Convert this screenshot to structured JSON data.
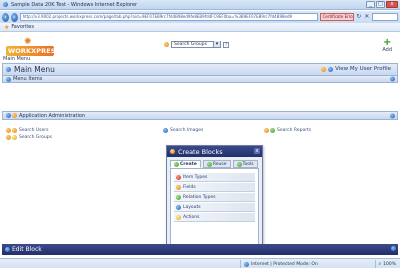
{
  "window": {
    "title": "Sample Data 20K Test - Windows Internet Explorer",
    "controls": [
      "_",
      "□",
      "x"
    ]
  },
  "address_bar": {
    "url": "http://v3.9002.projects.workxpress.com/page/tab.php?oid=9EF07EB9rc7fd4B98ed9fe8EB9fd4FC9EF0ba=%3B9EF07EB9rc7fd4B98ed9",
    "certificate_error": "Certificate Error"
  },
  "favorites": {
    "label": "Favorites"
  },
  "header": {
    "logo_text": "WORKXPRESS",
    "main_menu_label": "Main Menu",
    "group_select_value": "Search Groups",
    "help_label": "?",
    "add_label": "Add",
    "add_symbol": "+"
  },
  "main_menu_bar": {
    "title": "Main Menu",
    "view_my_user_profile": "View My User Profile"
  },
  "menu_items_bar": {
    "label": "Menu Items"
  },
  "app_admin_bar": {
    "label": "Application Administration"
  },
  "admin_links": {
    "search_users": "Search Users",
    "search_groups": "Search Groups",
    "search_images": "Search Images",
    "search_reports": "Search Reports"
  },
  "create_blocks": {
    "title": "Create Blocks",
    "close": "x",
    "tabs": [
      {
        "label": "Create",
        "icon": "create-icon"
      },
      {
        "label": "Reuse",
        "icon": "reuse-icon"
      },
      {
        "label": "Tools",
        "icon": "tools-icon"
      }
    ],
    "items": [
      {
        "label": "Item Types",
        "icon": "item-types-icon"
      },
      {
        "label": "Fields",
        "icon": "fields-icon"
      },
      {
        "label": "Relation Types",
        "icon": "relation-types-icon"
      },
      {
        "label": "Layouts",
        "icon": "layouts-icon"
      },
      {
        "label": "Actions",
        "icon": "actions-icon"
      }
    ]
  },
  "edit_block_bar": {
    "label": "Edit Block"
  },
  "status_bar": {
    "zone": "Internet | Protected Mode: On",
    "zoom": "100%"
  }
}
